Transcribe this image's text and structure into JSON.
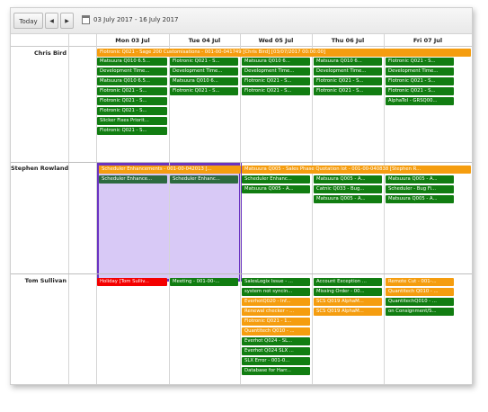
{
  "toolbar": {
    "today_label": "Today",
    "prev_label": "◀",
    "next_label": "▶",
    "date_range": "03 July 2017 - 16 July 2017"
  },
  "columns": [
    "Mon 03 Jul",
    "Tue 04 Jul",
    "Wed 05 Jul",
    "Thu 06 Jul",
    "Fri 07 Jul"
  ],
  "resources": [
    {
      "name": "Chris Bird",
      "spanning_event": "Flotronic Q021 - Sage 200 Customisations - 001-00-041749 [Chris Bird] [03/07/2017 00:00:00]",
      "events": [
        [
          "Matsuura Q010 6.5...",
          "Development Time...",
          "Matsuura Q010 6.5...",
          "Flotronic Q021 - S...",
          "Flotronic Q021 - S...",
          "Flotronic Q021 - S...",
          "Slicker Fixes Priorit...",
          "Flotronic Q021 - S..."
        ],
        [
          "Flotronic Q021 - S...",
          "Development Time...",
          "Matsuura Q010 6...",
          "Flotronic Q021 - S..."
        ],
        [
          "Matsuura Q010 6...",
          "Development Time...",
          "Flotronic Q021 - S...",
          "Flotronic Q021 - S..."
        ],
        [
          "Matsuura Q010 6...",
          "Development Time...",
          "Flotronic Q021 - S...",
          "Flotronic Q021 - S..."
        ],
        [
          "Flotronic Q021 - S...",
          "Development Time...",
          "Flotronic Q021 - S...",
          "Flotronic Q021 - S...",
          "AlphaTel - GRSQ00..."
        ]
      ]
    },
    {
      "name": "Stephen Rowland",
      "spanning_event_1": "Scheduler Enhancements - 001-00-042013 [...",
      "spanning_event_2": "Matsuura Q005 - Sales Phase Quotation lot - 001-00-040838 [Stephen R...",
      "events": [
        [
          "Scheduler Enhance..."
        ],
        [
          "Scheduler Enhanc..."
        ],
        [
          "Scheduler Enhanc...",
          "Matsuura Q005 - A..."
        ],
        [
          "Matsuura Q005 - A...",
          "Catnic Q033 - Bug...",
          "Matsuura Q005 - A..."
        ],
        [
          "Matsuura Q005 - A...",
          "Scheduler - Bug Fi...",
          "Matsuura Q005 - A..."
        ]
      ]
    },
    {
      "name": "Tom Sullivan",
      "events": [
        [
          "Holiday [Tom Sulliv..."
        ],
        [
          "Meeting - 001-00-..."
        ],
        [
          "SalesLogix Issue - ...",
          "system not syncin...",
          "EverhotQ020 - Inf...",
          "Renewal checker - ...",
          "Flotronic Q021 - 1...",
          "Quantitech Q010 - ...",
          "Everhot Q024 - SL...",
          "Everhot Q024 SLX ...",
          "SLX Error - 001-0...",
          "Database for Harr..."
        ],
        [
          "Account Exception ...",
          "Missing Order - 00...",
          "SCS Q019 AlphaM...",
          "SCS Q019 AlphaM..."
        ],
        [
          "Remote Cut - 001-...",
          "Quantitech Q010 - ...",
          "QuantitechQ010 - ...",
          "on Consignment/S..."
        ]
      ]
    }
  ],
  "colors": {
    "green": "#117d11",
    "orange": "#f59d0f",
    "red": "#f40000",
    "selection_fill": "#d8c9f6",
    "selection_border": "#6a33c2"
  }
}
